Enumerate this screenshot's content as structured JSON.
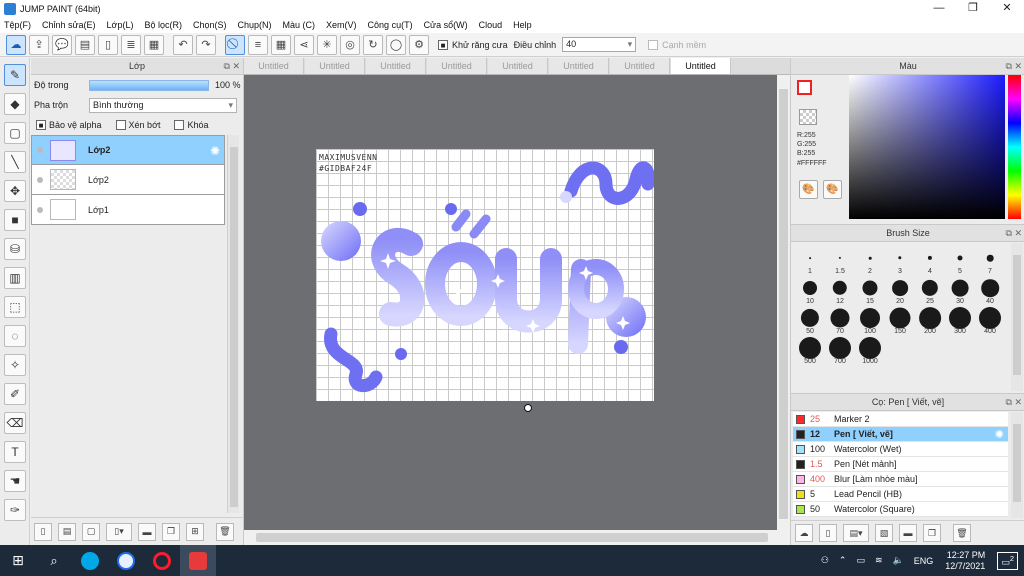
{
  "window": {
    "title": "JUMP PAINT (64bit)",
    "controls": [
      "—",
      "❐",
      "✕"
    ]
  },
  "menu": [
    "Tệp(F)",
    "Chỉnh sửa(E)",
    "Lớp(L)",
    "Bộ lọc(R)",
    "Chọn(S)",
    "Chụp(N)",
    "Màu (C)",
    "Xem(V)",
    "Công cụ(T)",
    "Cửa sổ(W)",
    "Cloud",
    "Help"
  ],
  "toolbar": {
    "antialias_label": "Khử răng cưa",
    "adjust_label": "Điều chỉnh",
    "adjust_value": "40",
    "snap_label": "Cạnh mềm"
  },
  "layer_panel": {
    "title": "Lớp",
    "opacity_label": "Độ trong",
    "opacity_value": "100 %",
    "opacity_fraction": 1.0,
    "blend_label": "Pha trộn",
    "blend_value": "Bình thường",
    "protect_alpha": "Bảo vệ alpha",
    "clip_label": "Xén bớt",
    "lock_label": "Khóa",
    "layers": [
      {
        "name": "Lớp2",
        "selected": true
      },
      {
        "name": "Lớp2",
        "selected": false
      },
      {
        "name": "Lớp1",
        "selected": false
      }
    ]
  },
  "tabs": [
    "Untitled",
    "Untitled",
    "Untitled",
    "Untitled",
    "Untitled",
    "Untitled",
    "Untitled",
    "Untitled"
  ],
  "canvas": {
    "watermark_line1": "MAXIMUSVENN",
    "watermark_line2": "#GIDBAF24F"
  },
  "color_panel": {
    "title": "Màu",
    "r": "R:255",
    "g": "G:255",
    "b": "B:255",
    "hex": "#FFFFFF",
    "accent": "#1b1bff"
  },
  "brush_panel": {
    "title": "Brush Size",
    "sizes": [
      "1",
      "1.5",
      "2",
      "3",
      "4",
      "5",
      "7",
      "10",
      "12",
      "15",
      "20",
      "25",
      "30",
      "40",
      "50",
      "70",
      "100",
      "150",
      "200",
      "300",
      "400",
      "500",
      "700",
      "1000"
    ]
  },
  "tool_panel": {
    "title": "Cọ: Pen [ Viết, vẽ]",
    "items": [
      {
        "size": "25",
        "name": "Marker 2",
        "color": "#ff2a2a",
        "selected": false
      },
      {
        "size": "12",
        "name": "Pen [ Viết, vẽ]",
        "color": "#222222",
        "selected": true
      },
      {
        "size": "100",
        "name": "Watercolor (Wet)",
        "color": "#9fe3ff",
        "selected": false
      },
      {
        "size": "1.5",
        "name": "Pen [Nét mảnh]",
        "color": "#222222",
        "selected": false
      },
      {
        "size": "400",
        "name": "Blur [Làm nhòe màu]",
        "color": "#ffb3e6",
        "selected": false
      },
      {
        "size": "5",
        "name": "Lead Pencil (HB)",
        "color": "#f0e01a",
        "selected": false
      },
      {
        "size": "50",
        "name": "Watercolor (Square)",
        "color": "#a8e64a",
        "selected": false
      }
    ]
  },
  "taskbar": {
    "lang": "ENG",
    "time": "12:27 PM",
    "date": "12/7/2021",
    "notif": "2"
  }
}
